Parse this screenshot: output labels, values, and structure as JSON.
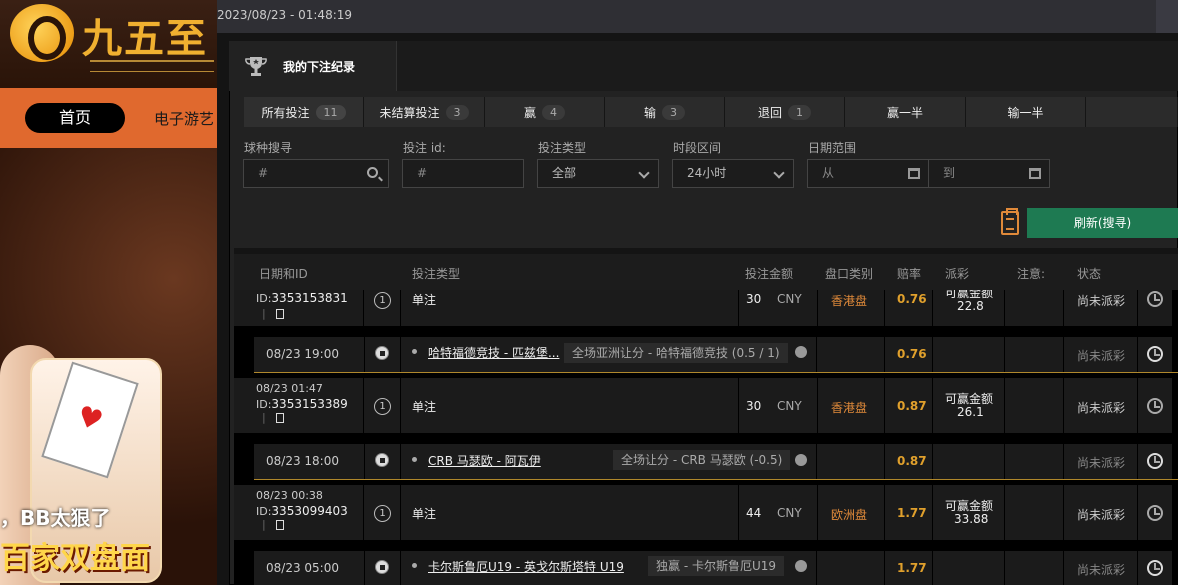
{
  "site": {
    "logo_text": "九五至",
    "nav_home": "首页",
    "nav_elec": "电子游艺",
    "banner_line1": "，BB太狠了",
    "banner_line2": "百家双盘面"
  },
  "topbar": {
    "datetime": "2023/08/23 - 01:48:19"
  },
  "modal": {
    "title": "我的下注纪录",
    "tabs": [
      {
        "label": "所有投注",
        "count": "11"
      },
      {
        "label": "未结算投注",
        "count": "3"
      },
      {
        "label": "赢",
        "count": "4"
      },
      {
        "label": "输",
        "count": "3"
      },
      {
        "label": "退回",
        "count": "1"
      },
      {
        "label": "赢一半",
        "count": ""
      },
      {
        "label": "输一半",
        "count": ""
      }
    ],
    "filters": {
      "sport_label": "球种搜寻",
      "sport_placeholder": "#",
      "betid_label": "投注 id:",
      "betid_placeholder": "#",
      "type_label": "投注类型",
      "type_value": "全部",
      "period_label": "时段区间",
      "period_value": "24小时",
      "date_label": "日期范围",
      "date_from": "从",
      "date_to": "到"
    },
    "refresh_label": "刷新(搜寻)",
    "columns": {
      "date_id": "日期和ID",
      "bet_type": "投注类型",
      "amount": "投注金额",
      "market": "盘口类别",
      "odds": "赔率",
      "payout": "派彩",
      "note": "注意:",
      "status": "状态"
    }
  },
  "bets": [
    {
      "date": "",
      "id_prefix": "ID:",
      "id": "3353153831",
      "count": "1",
      "type": "单注",
      "amount": "30",
      "currency": "CNY",
      "market": "香港盘",
      "odds": "0.76",
      "payout_label": "可赢金额",
      "payout": "22.8",
      "status": "尚未派彩",
      "sub": {
        "time": "08/23 19:00",
        "match": "哈特福德竞技 - 匹兹堡...",
        "pick": "全场亚洲让分 - 哈特福德竞技 (0.5 / 1)",
        "odds": "0.76",
        "status": "尚未派彩"
      }
    },
    {
      "date": "08/23 01:47",
      "id_prefix": "ID:",
      "id": "3353153389",
      "count": "1",
      "type": "单注",
      "amount": "30",
      "currency": "CNY",
      "market": "香港盘",
      "odds": "0.87",
      "payout_label": "可赢金额",
      "payout": "26.1",
      "status": "尚未派彩",
      "sub": {
        "time": "08/23 18:00",
        "match": "CRB 马瑟欧 - 阿瓦伊",
        "pick": "全场让分 - CRB 马瑟欧 (-0.5)",
        "odds": "0.87",
        "status": "尚未派彩"
      }
    },
    {
      "date": "08/23 00:38",
      "id_prefix": "ID:",
      "id": "3353099403",
      "count": "1",
      "type": "单注",
      "amount": "44",
      "currency": "CNY",
      "market": "欧洲盘",
      "odds": "1.77",
      "payout_label": "可赢金额",
      "payout": "33.88",
      "status": "尚未派彩",
      "sub": {
        "time": "08/23 05:00",
        "match": "卡尔斯鲁厄U19 - 英戈尔斯塔特 U19",
        "pick": "独赢 - 卡尔斯鲁厄U19",
        "odds": "1.77",
        "status": "尚未派彩"
      }
    }
  ]
}
